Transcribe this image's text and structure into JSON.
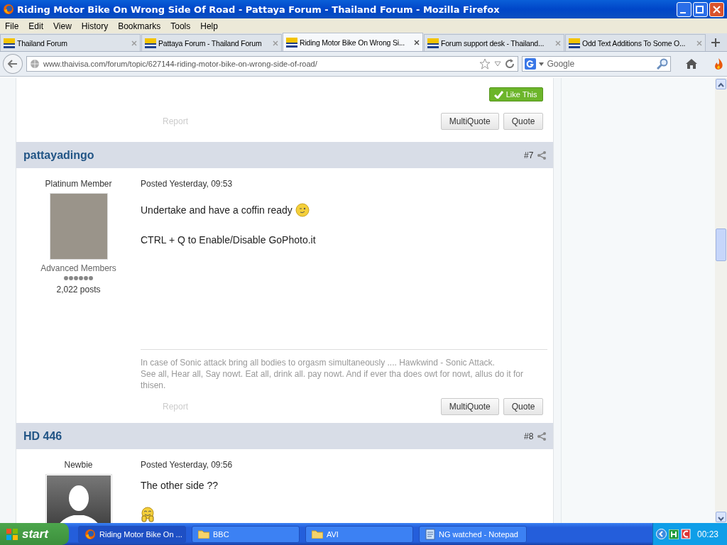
{
  "window": {
    "title": "Riding Motor Bike On Wrong Side Of Road - Pattaya Forum - Thailand Forum - Mozilla Firefox"
  },
  "menu": [
    "File",
    "Edit",
    "View",
    "History",
    "Bookmarks",
    "Tools",
    "Help"
  ],
  "tabs": [
    {
      "label": "Thailand Forum",
      "selected": false
    },
    {
      "label": "Pattaya Forum - Thailand Forum",
      "selected": false
    },
    {
      "label": "Riding Motor Bike On Wrong Si...",
      "selected": true
    },
    {
      "label": "Forum support desk - Thailand...",
      "selected": false
    },
    {
      "label": "Odd Text Additions To Some O...",
      "selected": false
    }
  ],
  "address": {
    "value": "www.thaivisa.com/forum/topic/627144-riding-motor-bike-on-wrong-side-of-road/"
  },
  "search": {
    "placeholder": "Google"
  },
  "previous_post": {
    "like_button": "Like This",
    "report": "Report",
    "buttons": [
      "MultiQuote",
      "Quote"
    ]
  },
  "posts": [
    {
      "author": "pattayadingo",
      "number": "#7",
      "rank": "Platinum Member",
      "group": "Advanced Members",
      "post_count": "2,022 posts",
      "posted": "Posted Yesterday, 09:53",
      "body": [
        {
          "kind": "winking",
          "text": "Undertake and have a coffin ready"
        },
        {
          "kind": "text",
          "text": "CTRL + Q to Enable/Disable GoPhoto.it"
        }
      ],
      "signature": [
        "In case of Sonic attack bring all bodies to orgasm simultaneously .... Hawkwind - Sonic Attack.",
        "See all, Hear all, Say nowt. Eat all, drink all. pay nowt. And if ever tha does owt for nowt, allus do it for thisen."
      ],
      "report": "Report",
      "buttons": [
        "MultiQuote",
        "Quote"
      ]
    },
    {
      "author": "HD 446",
      "number": "#8",
      "rank": "Newbie",
      "posted": "Posted Yesterday, 09:56",
      "body": [
        {
          "kind": "text",
          "text": "The other side ??"
        },
        {
          "kind": "grinning"
        }
      ]
    }
  ],
  "taskbar": {
    "start": "start",
    "tasks": [
      {
        "label": "Riding Motor Bike On ...",
        "selected": true
      },
      {
        "label": "BBC",
        "selected": false
      },
      {
        "label": "AVI",
        "selected": false
      },
      {
        "label": "NG watched - Notepad",
        "selected": false
      }
    ],
    "clock": "00:23"
  }
}
